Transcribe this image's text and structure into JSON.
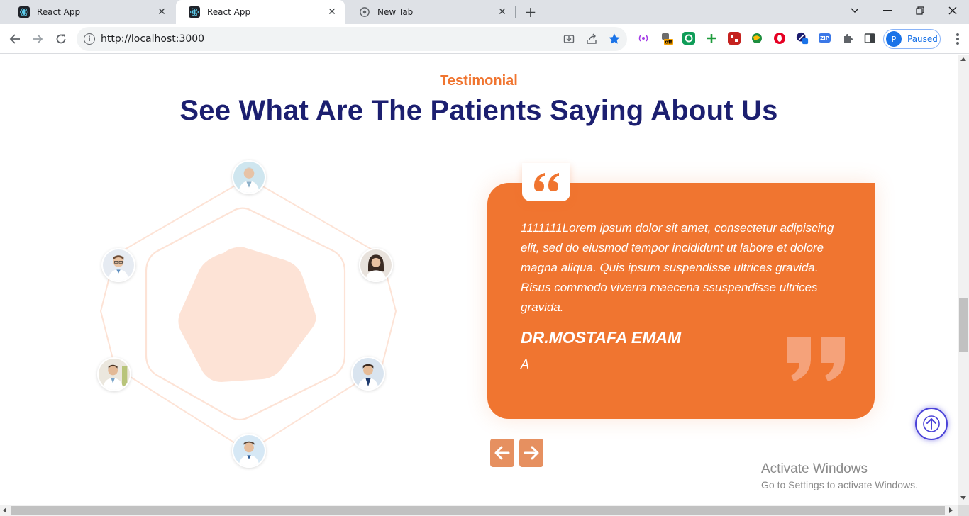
{
  "browser": {
    "tabs": [
      {
        "title": "React App",
        "icon": "react-icon",
        "active": false
      },
      {
        "title": "React App",
        "icon": "react-icon",
        "active": true
      },
      {
        "title": "New Tab",
        "icon": "chrome-icon",
        "active": false
      }
    ],
    "url": "http://localhost:3000",
    "profile_label": "Paused",
    "profile_initial": "P",
    "extension_badge": "off",
    "zip_badge": "ZIP"
  },
  "testimonial": {
    "eyebrow": "Testimonial",
    "title": "See What Are The Patients Saying About Us",
    "quote_text": "1111111Lorem ipsum dolor sit amet, consectetur adipiscing elit, sed do eiusmod tempor incididunt ut labore et dolore magna aliqua. Quis ipsum suspendisse ultrices gravida. Risus commodo viverra maecena ssuspendisse ultrices gravida.",
    "author_name": "DR.MOSTAFA EMAM",
    "author_role": "A",
    "prev_icon": "arrow-left-icon",
    "next_icon": "arrow-right-icon"
  },
  "overlay": {
    "activate_title": "Activate Windows",
    "activate_sub": "Go to Settings to activate Windows."
  },
  "colors": {
    "accent": "#f07530",
    "heading": "#1c1f70",
    "arrow_button": "#e69060",
    "scroll_top_ring": "#4b43d8",
    "hex_fill": "#fde3d6"
  }
}
